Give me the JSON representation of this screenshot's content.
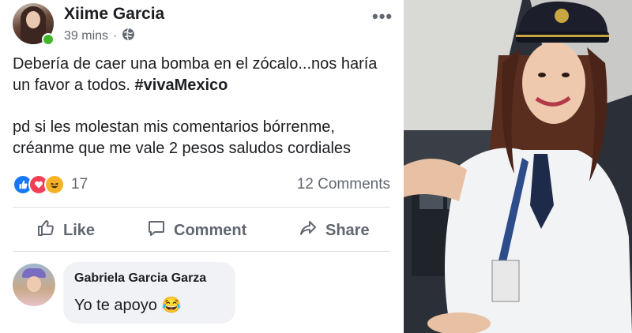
{
  "post": {
    "author": "Xiime Garcia",
    "time": "39 mins",
    "separator": "·",
    "visibility_icon": "globe-icon",
    "more_label": "•••",
    "text_line1": "Debería de caer una bomba en el zócalo...nos haría un favor a todos.",
    "hashtag": "#vivaMexico",
    "text_line2": "pd si les molestan mis comentarios bórrenme, créanme que me vale 2 pesos  saludos cordiales",
    "reaction_icons": [
      "like-icon",
      "love-icon",
      "haha-icon"
    ],
    "reaction_count": "17",
    "comments_count": "12 Comments"
  },
  "actions": {
    "like_label": "Like",
    "comment_label": "Comment",
    "share_label": "Share"
  },
  "comment": {
    "author": "Gabriela Garcia Garza",
    "text": "Yo te apoyo 😂"
  },
  "colors": {
    "text": "#1c1e21",
    "secondary": "#606770",
    "bubble": "#f0f2f5",
    "online": "#42b72a",
    "like": "#1877f2",
    "love": "#f33e58",
    "haha": "#f7b125"
  }
}
